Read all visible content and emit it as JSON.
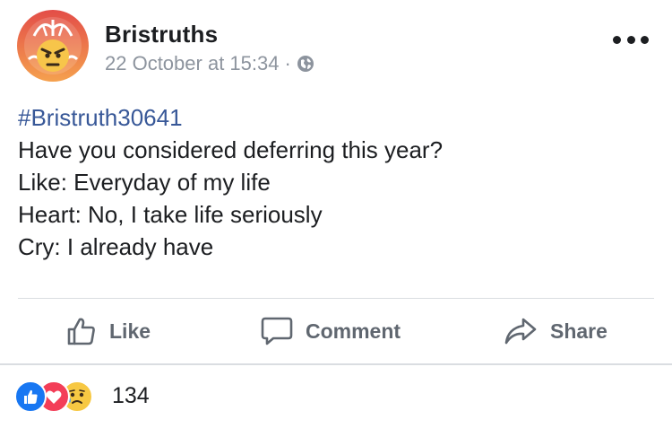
{
  "post": {
    "author": "Bristruths",
    "date": "22 October at 15:34",
    "separator": "·",
    "privacy_icon": "globe-icon",
    "hashtag": "#Bristruth30641",
    "lines": [
      "Have you considered deferring this year?",
      "Like: Everyday of my life",
      "Heart: No, I take life seriously",
      "Cry: I already have"
    ]
  },
  "actions": {
    "like": "Like",
    "comment": "Comment",
    "share": "Share"
  },
  "reactions": {
    "icons": [
      "like-reaction-icon",
      "love-reaction-icon",
      "sad-reaction-icon"
    ],
    "count": "134"
  },
  "colors": {
    "hashtag": "#385898",
    "like_blue": "#1877f2",
    "love_red": "#f33e58",
    "sad_yellow": "#f7c843",
    "avatar_red": "#e1504a",
    "avatar_orange": "#f39a4c"
  }
}
